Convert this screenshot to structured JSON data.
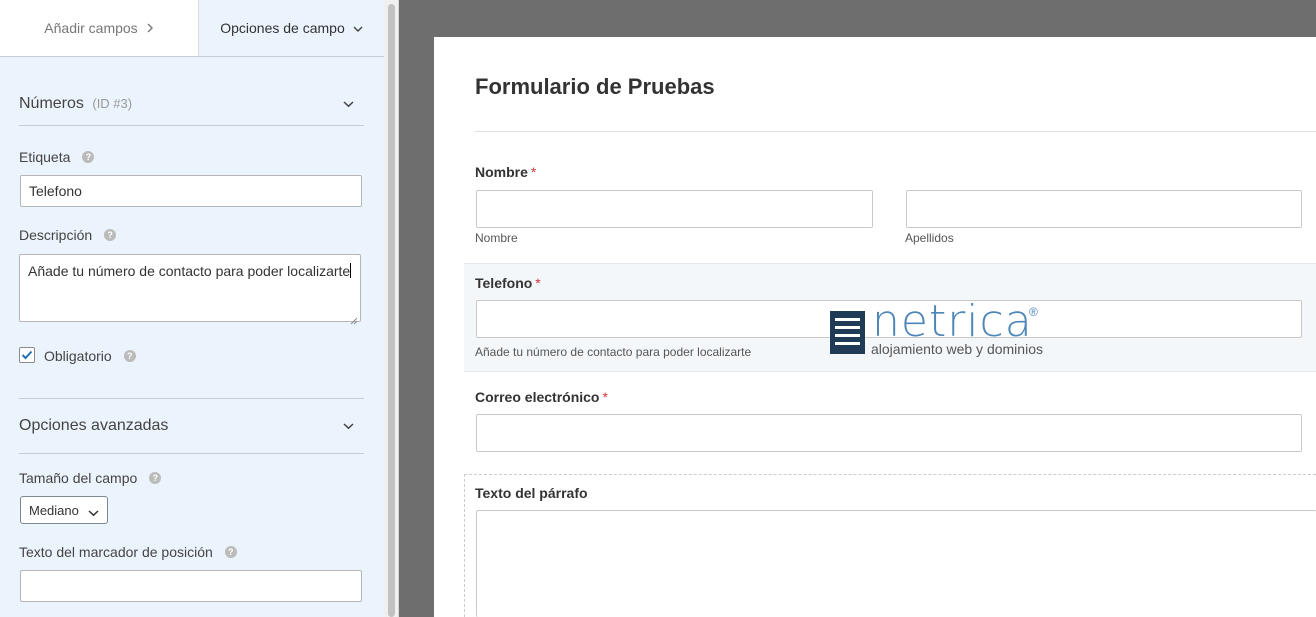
{
  "tabs": {
    "add_fields": "Añadir campos",
    "field_options": "Opciones de campo"
  },
  "field_panel": {
    "section_title": "Números",
    "section_id": "(ID #3)",
    "label_caption": "Etiqueta",
    "label_value": "Telefono",
    "description_caption": "Descripción",
    "description_value": "Añade tu número de contacto para poder localizarte",
    "required_label": "Obligatorio",
    "required_checked": true,
    "advanced_title": "Opciones avanzadas",
    "size_caption": "Tamaño del campo",
    "size_value": "Mediano",
    "placeholder_caption": "Texto del marcador de posición",
    "placeholder_value": ""
  },
  "form": {
    "title": "Formulario de Pruebas",
    "required_mark": "*",
    "name_label": "Nombre",
    "first_sublabel": "Nombre",
    "last_sublabel": "Apellidos",
    "phone_label": "Telefono",
    "phone_description": "Añade tu número de contacto para poder localizarte",
    "email_label": "Correo electrónico",
    "paragraph_label": "Texto del párrafo"
  },
  "watermark": {
    "brand": "netrica",
    "registered": "®",
    "tagline": "alojamiento web y dominios"
  },
  "colors": {
    "panel_bg": "#ebf3fc",
    "preview_bg": "#6e6e6e",
    "required": "#d63638",
    "brand_blue": "#4d86b8",
    "brand_dark": "#1f3b56"
  }
}
